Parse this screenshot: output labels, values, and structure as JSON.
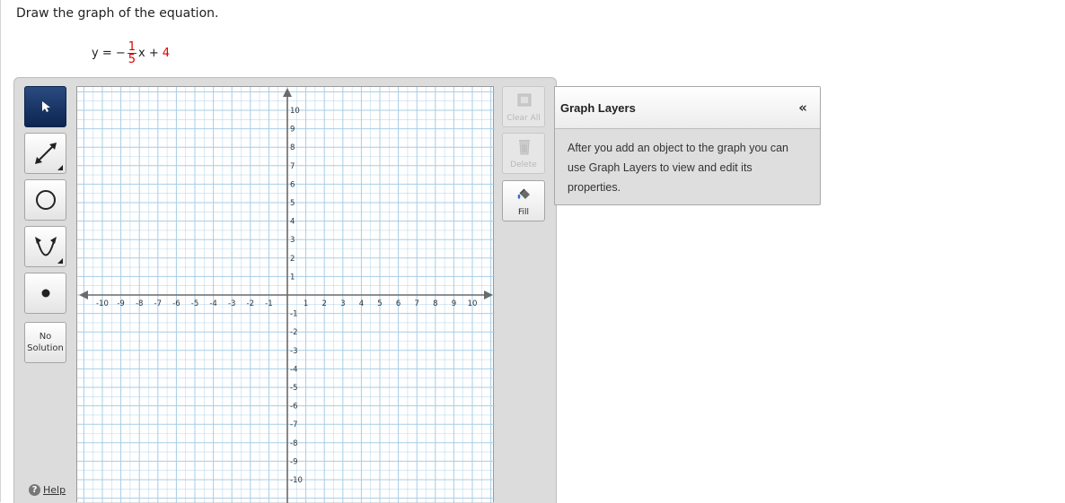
{
  "instruction": "Draw the graph of the equation.",
  "equation": {
    "lhs": "y = −",
    "numerator": "1",
    "denominator": "5",
    "var": "x +",
    "constant": "4"
  },
  "left_tools": [
    {
      "name": "select-tool-button",
      "icon": "arrow-cursor-icon",
      "active": true
    },
    {
      "name": "line-tool-button",
      "icon": "line-segment-icon",
      "active": false
    },
    {
      "name": "circle-tool-button",
      "icon": "circle-icon",
      "active": false
    },
    {
      "name": "parabola-tool-button",
      "icon": "parabola-icon",
      "active": false
    },
    {
      "name": "point-tool-button",
      "icon": "point-icon",
      "active": false
    }
  ],
  "no_solution_label": "No Solution",
  "help_label": "Help",
  "right_tools": {
    "clear_all": "Clear All",
    "delete": "Delete",
    "fill": "Fill"
  },
  "graph": {
    "x_min": -10,
    "x_max": 10,
    "y_min": -10,
    "y_max": 10,
    "x_tick_labels": [
      "-10",
      "-9",
      "-8",
      "-7",
      "-6",
      "-5",
      "-4",
      "-3",
      "-2",
      "-1",
      "1",
      "2",
      "3",
      "4",
      "5",
      "6",
      "7",
      "8",
      "9",
      "10"
    ],
    "y_tick_labels": [
      "10",
      "9",
      "8",
      "7",
      "6",
      "5",
      "4",
      "3",
      "2",
      "1",
      "-1",
      "-2",
      "-3",
      "-4",
      "-5",
      "-6",
      "-7",
      "-8",
      "-9",
      "-10"
    ],
    "grid_color": "#a7cde6",
    "axis_color": "#6a6a6a"
  },
  "layers": {
    "title": "Graph Layers",
    "collapse_symbol": "«",
    "body": "After you add an object to the graph you can use Graph Layers to view and edit its properties."
  }
}
